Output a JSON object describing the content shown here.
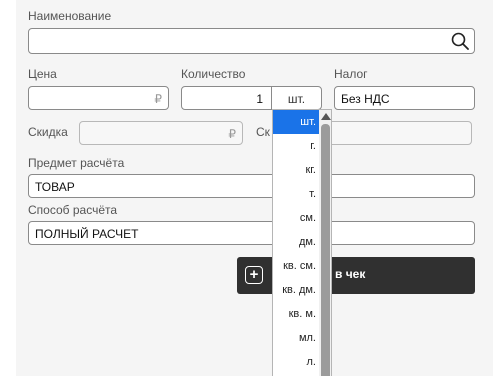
{
  "labels": {
    "name": "Наименование",
    "price": "Цена",
    "quantity": "Количество",
    "tax": "Налог",
    "discount": "Скидка",
    "discount_sum_partial": "Ск",
    "subject": "Предмет расчёта",
    "method": "Способ расчёта"
  },
  "fields": {
    "name_value": "",
    "price_value": "",
    "currency": "₽",
    "quantity_value": "1",
    "unit_value": "шт.",
    "tax_value": "Без НДС",
    "discount_value": "",
    "subject_value": "ТОВАР",
    "method_value": "ПОЛНЫЙ РАСЧЕТ"
  },
  "add_button": {
    "label": "в чек"
  },
  "unit_dropdown": {
    "options": [
      "шт.",
      "г.",
      "кг.",
      "т.",
      "см.",
      "дм.",
      "кв. см.",
      "кв. дм.",
      "кв. м.",
      "мл.",
      "л."
    ],
    "selected": "шт."
  },
  "icons": {
    "search": "search-icon",
    "add": "plus-square-icon",
    "scroll_up": "scroll-up-arrow-icon"
  },
  "colors": {
    "selected": "#1a73e8",
    "button": "#303030"
  }
}
